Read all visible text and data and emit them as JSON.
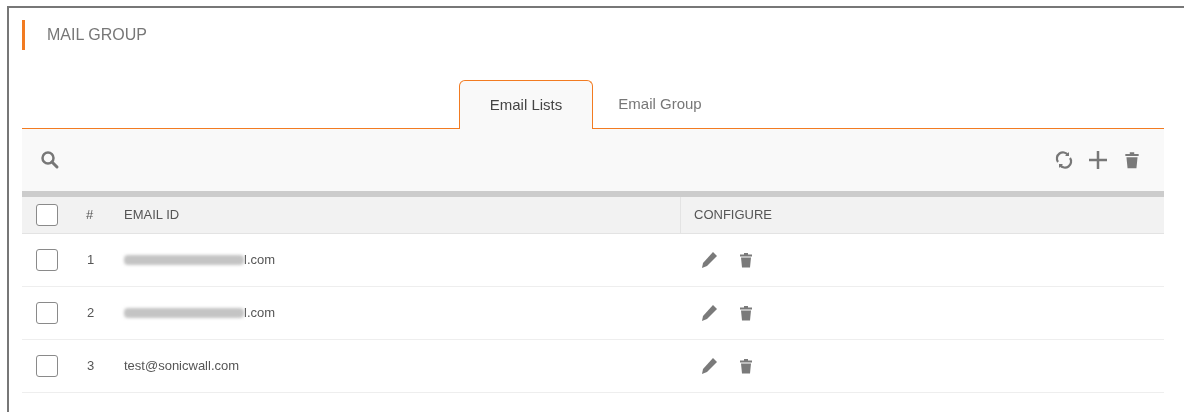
{
  "section_title": "MAIL GROUP",
  "tabs": [
    {
      "label": "Email Lists",
      "selected": true
    },
    {
      "label": "Email Group",
      "selected": false
    }
  ],
  "table": {
    "columns": [
      "#",
      "EMAIL ID",
      "CONFIGURE"
    ],
    "header_checked": false,
    "rows": [
      {
        "checked": false,
        "number": "1",
        "email": "l.com",
        "redacted": true
      },
      {
        "checked": false,
        "number": "2",
        "email": "l.com",
        "redacted": true
      },
      {
        "checked": false,
        "number": "3",
        "email": "test@sonicwall.com",
        "redacted": false
      }
    ]
  }
}
